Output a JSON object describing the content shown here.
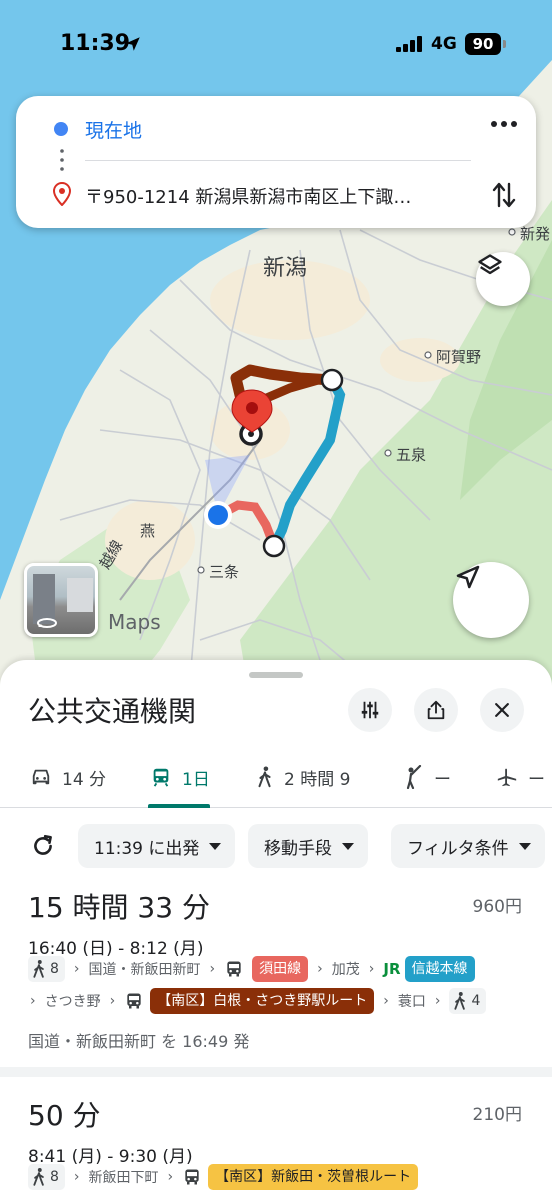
{
  "status_bar": {
    "time": "11:39",
    "network": "4G",
    "battery": "90"
  },
  "search": {
    "origin": "現在地",
    "destination": "〒950-1214 新潟県新潟市南区上下諏…"
  },
  "map": {
    "labels": {
      "niigata": "新潟",
      "agano": "阿賀野",
      "gosen": "五泉",
      "sanjo": "三条",
      "tsubame": "燕",
      "line": "越線",
      "shinhatsuda": "新発"
    },
    "maps_logo": "Maps",
    "colors": {
      "sea": "#74c6ec",
      "land": "#eef0e6",
      "route_bus_brown": "#8a2f08",
      "route_rail_blue": "#23a0c9",
      "route_bus_red": "#e8675f"
    }
  },
  "sheet": {
    "title": "公共交通機関",
    "modes": [
      {
        "icon": "car-icon",
        "label": "14 分"
      },
      {
        "icon": "train-icon",
        "label": "1日"
      },
      {
        "icon": "walk-icon",
        "label": "2 時間 9"
      },
      {
        "icon": "hail-icon",
        "label": "ー"
      },
      {
        "icon": "airplane-icon",
        "label": "ー"
      }
    ],
    "chips": {
      "depart": "11:39 に出発",
      "modes": "移動手段",
      "filters": "フィルタ条件"
    }
  },
  "routes": [
    {
      "duration": "15 時間 33 分",
      "fare": "960円",
      "times": "16:40 (日) - 8:12 (月)",
      "line1": {
        "walk": "8",
        "stop1": "国道・新飯田新町",
        "bus1": "須田線",
        "stop2": "加茂",
        "jr_logo": "JR",
        "rail": "信越本線"
      },
      "line2": {
        "stop3": "さつき野",
        "bus2": "【南区】白根・さつき野駅ルート",
        "stop4": "蓑口",
        "walk": "4"
      },
      "departure": "国道・新飯田新町 を 16:49 発"
    },
    {
      "duration": "50 分",
      "fare": "210円",
      "times": "8:41 (月) - 9:30 (月)",
      "line1": {
        "walk": "8",
        "stop1": "新飯田下町",
        "bus1": "【南区】新飯田・茨曽根ルート"
      }
    }
  ]
}
